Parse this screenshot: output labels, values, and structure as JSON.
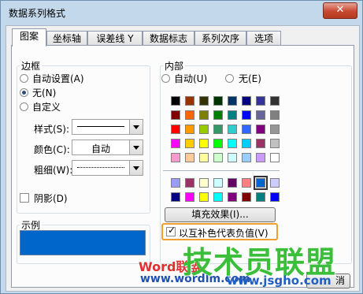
{
  "window": {
    "title": "数据系列格式",
    "close": "✕"
  },
  "tabs": [
    "图案",
    "坐标轴",
    "误差线 Y",
    "数据标志",
    "系列次序",
    "选项"
  ],
  "border": {
    "title": "边框",
    "options": [
      "自动设置(A)",
      "无(N)",
      "自定义"
    ],
    "style_label": "样式(S):",
    "color_label": "颜色(C):",
    "color_value": "自动",
    "weight_label": "粗细(W):",
    "shadow_label": "阴影(D)"
  },
  "sample": {
    "title": "示例"
  },
  "area": {
    "title": "内部",
    "auto_label": "自动(U)",
    "none_label": "无(E)",
    "fill_effects": "填充效果(I)...",
    "invert_label": "以互补色代表负值(V)"
  },
  "palette_main": [
    [
      "#000000",
      "#993300",
      "#333300",
      "#003300",
      "#003366",
      "#000080",
      "#333399",
      "#333333"
    ],
    [
      "#800000",
      "#FF6600",
      "#808000",
      "#008000",
      "#008080",
      "#0000FF",
      "#666699",
      "#808080"
    ],
    [
      "#FF0000",
      "#FF9900",
      "#99CC00",
      "#339966",
      "#33CCCC",
      "#3366FF",
      "#800080",
      "#969696"
    ],
    [
      "#FF00FF",
      "#FFCC00",
      "#FFFF00",
      "#00FF00",
      "#00FFFF",
      "#00CCFF",
      "#993366",
      "#C0C0C0"
    ],
    [
      "#FF99CC",
      "#FFCC99",
      "#FFFF99",
      "#CCFFCC",
      "#CCFFFF",
      "#99CCFF",
      "#CC99FF",
      "#FFFFFF"
    ]
  ],
  "palette_extra": [
    [
      "#9999FF",
      "#993366",
      "#FFFFCC",
      "#CCFFFF",
      "#660066",
      "#FF8080",
      "#0066CC",
      "#CCCCFF"
    ],
    [
      "#000080",
      "#FF00FF",
      "#FFFF00",
      "#00FFFF",
      "#800080",
      "#800000",
      "#008080",
      "#0000FF"
    ]
  ],
  "sample_color": "#0066CC",
  "highlight_color": "#F0A030",
  "watermark": {
    "line1": "Word联盟",
    "line2": "www.wordlm.com",
    "big": "技术员联盟",
    "url": "www.jsgho.com"
  },
  "footer": {
    "button_partial": "消"
  }
}
